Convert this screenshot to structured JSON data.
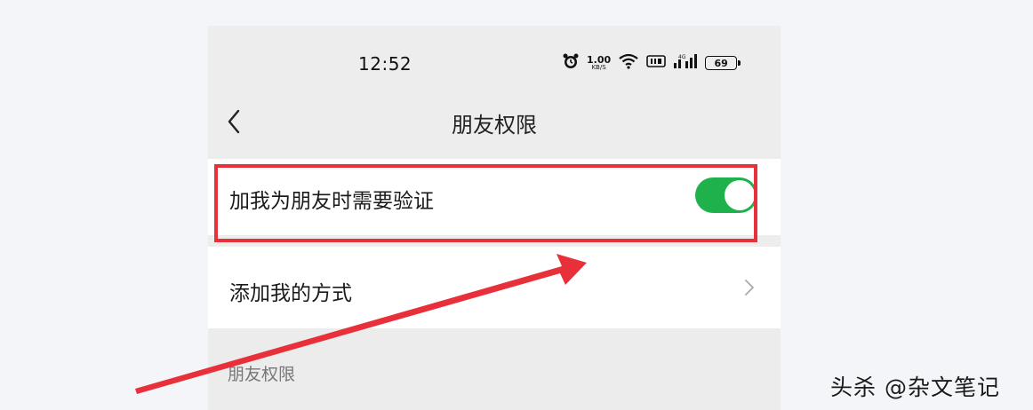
{
  "status_bar": {
    "time": "12:52",
    "net_speed_value": "1.00",
    "net_speed_unit": "KB/S",
    "battery_level": "69",
    "icons": [
      "alarm-icon",
      "wifi-icon",
      "hd-icon",
      "signal-icon",
      "battery-icon"
    ]
  },
  "nav": {
    "back_icon": "chevron-left-icon",
    "title": "朋友权限"
  },
  "settings": {
    "verify_label": "加我为朋友时需要验证",
    "verify_enabled": true,
    "add_method_label": "添加我的方式",
    "section_header": "朋友权限"
  },
  "annotations": {
    "highlight_color": "#e8303a",
    "arrow_color": "#e8303a"
  },
  "watermark": "头杀 @杂文笔记",
  "colors": {
    "toggle_on": "#1fb14c",
    "page_bg": "#ededed",
    "row_bg": "#ffffff"
  }
}
